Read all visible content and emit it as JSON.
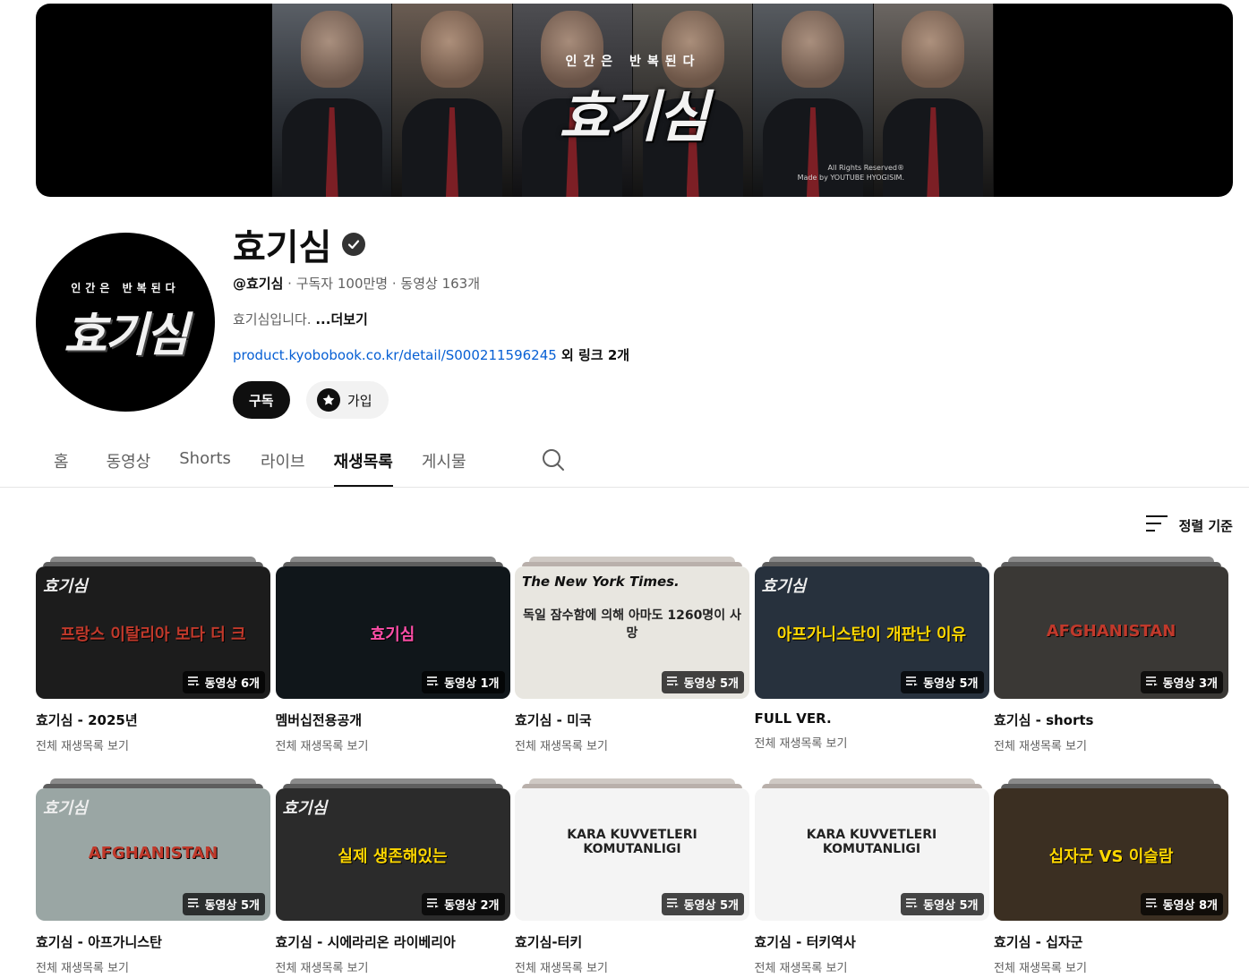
{
  "banner": {
    "subtitle": "인간은 반복된다",
    "title": "효기심",
    "credit_line1": "All Rights Reserved®",
    "credit_line2": "Made by YOUTUBE HYOGISIM."
  },
  "avatar": {
    "subtitle": "인간은 반복된다",
    "title": "효기심"
  },
  "channel": {
    "name": "효기심",
    "handle": "@효기심",
    "meta": " · 구독자 100만명 · 동영상 163개",
    "description": "효기심입니다. ",
    "more": "...더보기",
    "link_url": "product.kyobobook.co.kr/detail/S000211596245",
    "link_extra": " 외 링크 2개"
  },
  "buttons": {
    "subscribe": "구독",
    "join": "가입"
  },
  "tabs": [
    {
      "label": "홈"
    },
    {
      "label": "동영상"
    },
    {
      "label": "Shorts"
    },
    {
      "label": "라이브"
    },
    {
      "label": "재생목록"
    },
    {
      "label": "게시물"
    }
  ],
  "sort": {
    "label": "정렬 기준"
  },
  "playlists": [
    {
      "title": "효기심 - 2025년",
      "link": "전체 재생목록 보기",
      "count": "동영상 6개",
      "overlay_text": "프랑스 이탈리아 보다 더 크",
      "logo": "효기심",
      "bg": "#1c1c1c",
      "accent": "#c0392b"
    },
    {
      "title": "멤버십전용공개",
      "link": "전체 재생목록 보기",
      "count": "동영상 1개",
      "overlay_text": "효기심",
      "logo": "",
      "bg": "#10161a",
      "accent": "#ff4fa8"
    },
    {
      "title": "효기심 - 미국",
      "link": "전체 재생목록 보기",
      "count": "동영상 5개",
      "overlay_text": "독일 잠수함에 의해 아마도 1260명이 사망",
      "logo": "The New York Times.",
      "bg": "#e8e6e0",
      "accent": "#d40000"
    },
    {
      "title": "FULL VER.",
      "link": "전체 재생목록 보기",
      "count": "동영상 5개",
      "overlay_text": "아프가니스탄이 개판난 이유",
      "logo": "효기심",
      "bg": "#27313d",
      "accent": "#ffd800"
    },
    {
      "title": "효기심 - shorts",
      "link": "전체 재생목록 보기",
      "count": "동영상 3개",
      "overlay_text": "AFGHANISTAN",
      "logo": "",
      "bg": "#3a3835",
      "accent": "#c0392b"
    },
    {
      "title": "효기심 - 아프가니스탄",
      "link": "전체 재생목록 보기",
      "count": "동영상 5개",
      "overlay_text": "AFGHANISTAN",
      "logo": "효기심",
      "bg": "#9aa6a4",
      "accent": "#c0392b"
    },
    {
      "title": "효기심 - 시에라리온 라이베리아",
      "link": "전체 재생목록 보기",
      "count": "동영상 2개",
      "overlay_text": "실제 생존해있는",
      "logo": "효기심",
      "bg": "#2b2b2b",
      "accent": "#ffd800"
    },
    {
      "title": "효기심-터키",
      "link": "전체 재생목록 보기",
      "count": "동영상 5개",
      "overlay_text": "KARA KUVVETLERI KOMUTANLIGI",
      "logo": "",
      "bg": "#f4f4f4",
      "accent": "#e00000"
    },
    {
      "title": "효기심 - 터키역사",
      "link": "전체 재생목록 보기",
      "count": "동영상 5개",
      "overlay_text": "KARA KUVVETLERI KOMUTANLIGI",
      "logo": "",
      "bg": "#f4f4f4",
      "accent": "#e00000"
    },
    {
      "title": "효기심 - 십자군",
      "link": "전체 재생목록 보기",
      "count": "동영상 8개",
      "overlay_text": "십자군 VS 이슬람",
      "logo": "",
      "bg": "#3b2f22",
      "accent": "#ffd800"
    }
  ],
  "colors": {
    "link": "#065fd4",
    "text": "#0f0f0f",
    "secondary": "#606060",
    "chip": "#f2f2f2"
  },
  "icons": {
    "verified": "check-circle-icon",
    "join": "star-icon",
    "search": "search-icon",
    "sort": "sort-icon",
    "playlist": "playlist-icon"
  }
}
